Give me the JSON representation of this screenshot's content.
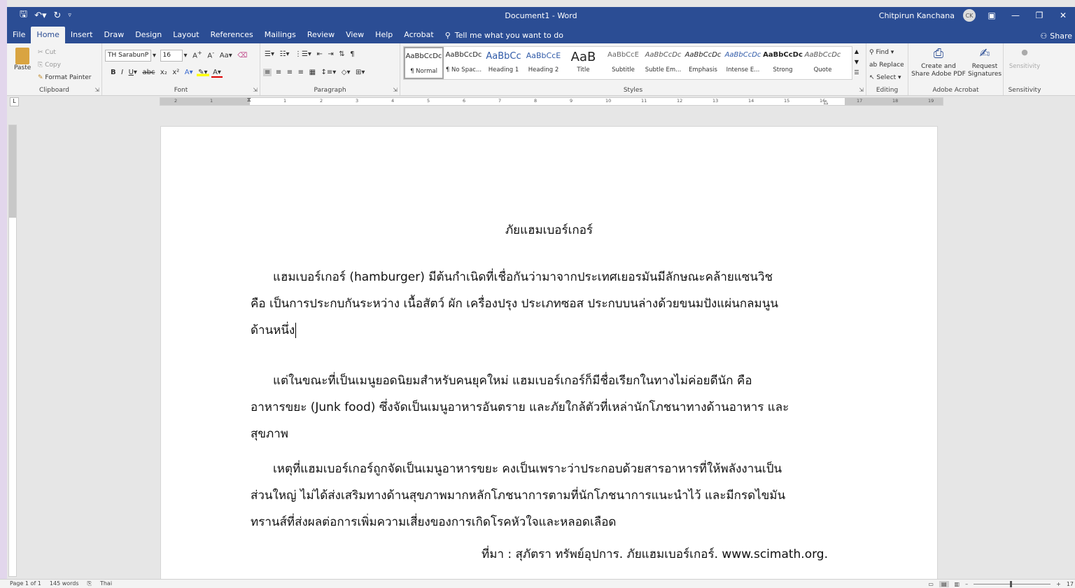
{
  "titlebar": {
    "doc_title": "Document1 - Word",
    "user_name": "Chitpirun Kanchana",
    "user_initials": "CK"
  },
  "tabs": [
    "File",
    "Home",
    "Insert",
    "Draw",
    "Design",
    "Layout",
    "References",
    "Mailings",
    "Review",
    "View",
    "Help",
    "Acrobat"
  ],
  "active_tab": "Home",
  "tell_me": "Tell me what you want to do",
  "share_label": "Share",
  "ribbon": {
    "clipboard": {
      "paste": "Paste",
      "cut": "Cut",
      "copy": "Copy",
      "format_painter": "Format Painter",
      "label": "Clipboard"
    },
    "font": {
      "name": "TH SarabunP",
      "size": "16",
      "label": "Font"
    },
    "paragraph": {
      "label": "Paragraph"
    },
    "styles": {
      "label": "Styles",
      "items": [
        {
          "sample": "AaBbCcDc",
          "name": "¶ Normal"
        },
        {
          "sample": "AaBbCcDc",
          "name": "¶ No Spac..."
        },
        {
          "sample": "AaBbCc",
          "name": "Heading 1"
        },
        {
          "sample": "AaBbCcE",
          "name": "Heading 2"
        },
        {
          "sample": "AaB",
          "name": "Title"
        },
        {
          "sample": "AaBbCcE",
          "name": "Subtitle"
        },
        {
          "sample": "AaBbCcDc",
          "name": "Subtle Em..."
        },
        {
          "sample": "AaBbCcDc",
          "name": "Emphasis"
        },
        {
          "sample": "AaBbCcDc",
          "name": "Intense E..."
        },
        {
          "sample": "AaBbCcDc",
          "name": "Strong"
        },
        {
          "sample": "AaBbCcDc",
          "name": "Quote"
        }
      ]
    },
    "editing": {
      "find": "Find",
      "replace": "Replace",
      "select": "Select",
      "label": "Editing"
    },
    "acrobat": {
      "create_share": "Create and Share Adobe PDF",
      "request_sig": "Request Signatures",
      "label": "Adobe Acrobat"
    },
    "sensitivity": {
      "button": "Sensitivity",
      "label": "Sensitivity"
    }
  },
  "ruler_numbers": [
    "2",
    "1",
    "1",
    "2",
    "3",
    "4",
    "5",
    "6",
    "7",
    "8",
    "9",
    "10",
    "11",
    "12",
    "13",
    "14",
    "15",
    "16",
    "17",
    "18",
    "19"
  ],
  "document": {
    "heading": "ภัยแฮมเบอร์เกอร์",
    "para1": [
      "แฮมเบอร์เกอร์ (hamburger) มีต้นกำเนิดที่เชื่อกันว่ามาจากประเทศเยอรมันมีลักษณะคล้ายแซนวิช",
      "คือ เป็นการประกบกันระหว่าง เนื้อสัตว์ ผัก เครื่องปรุง ประเภทซอส ประกบบนล่างด้วยขนมปังแผ่นกลมนูน",
      "ด้านหนึ่ง"
    ],
    "para2": [
      "แต่ในขณะที่เป็นเมนูยอดนิยมสำหรับคนยุคใหม่ แฮมเบอร์เกอร์ก็มีชื่อเรียกในทางไม่ค่อยดีนัก คือ",
      "อาหารขยะ (Junk food) ซึ่งจัดเป็นเมนูอาหารอันตราย และภัยใกล้ตัวที่เหล่านักโภชนาทางด้านอาหาร และ",
      "สุขภาพ"
    ],
    "para3": [
      "เหตุที่แฮมเบอร์เกอร์ถูกจัดเป็นเมนูอาหารขยะ คงเป็นเพราะว่าประกอบด้วยสารอาหารที่ให้พลังงานเป็น",
      "ส่วนใหญ่ ไม่ได้ส่งเสริมทางด้านสุขภาพมากหลักโภชนาการตามที่นักโภชนาการแนะนำไว้ และมีกรดไขมัน",
      "ทรานส์ที่ส่งผลต่อการเพิ่มความเสี่ยงของการเกิดโรคหัวใจและหลอดเลือด"
    ],
    "source": "ที่มา : สุภัตรา ทรัพย์อุปการ. ภัยแฮมเบอร์เกอร์. www.scimath.org."
  },
  "status": {
    "page": "Page 1 of 1",
    "words": "145 words",
    "language": "Thai",
    "zoom": "17"
  }
}
